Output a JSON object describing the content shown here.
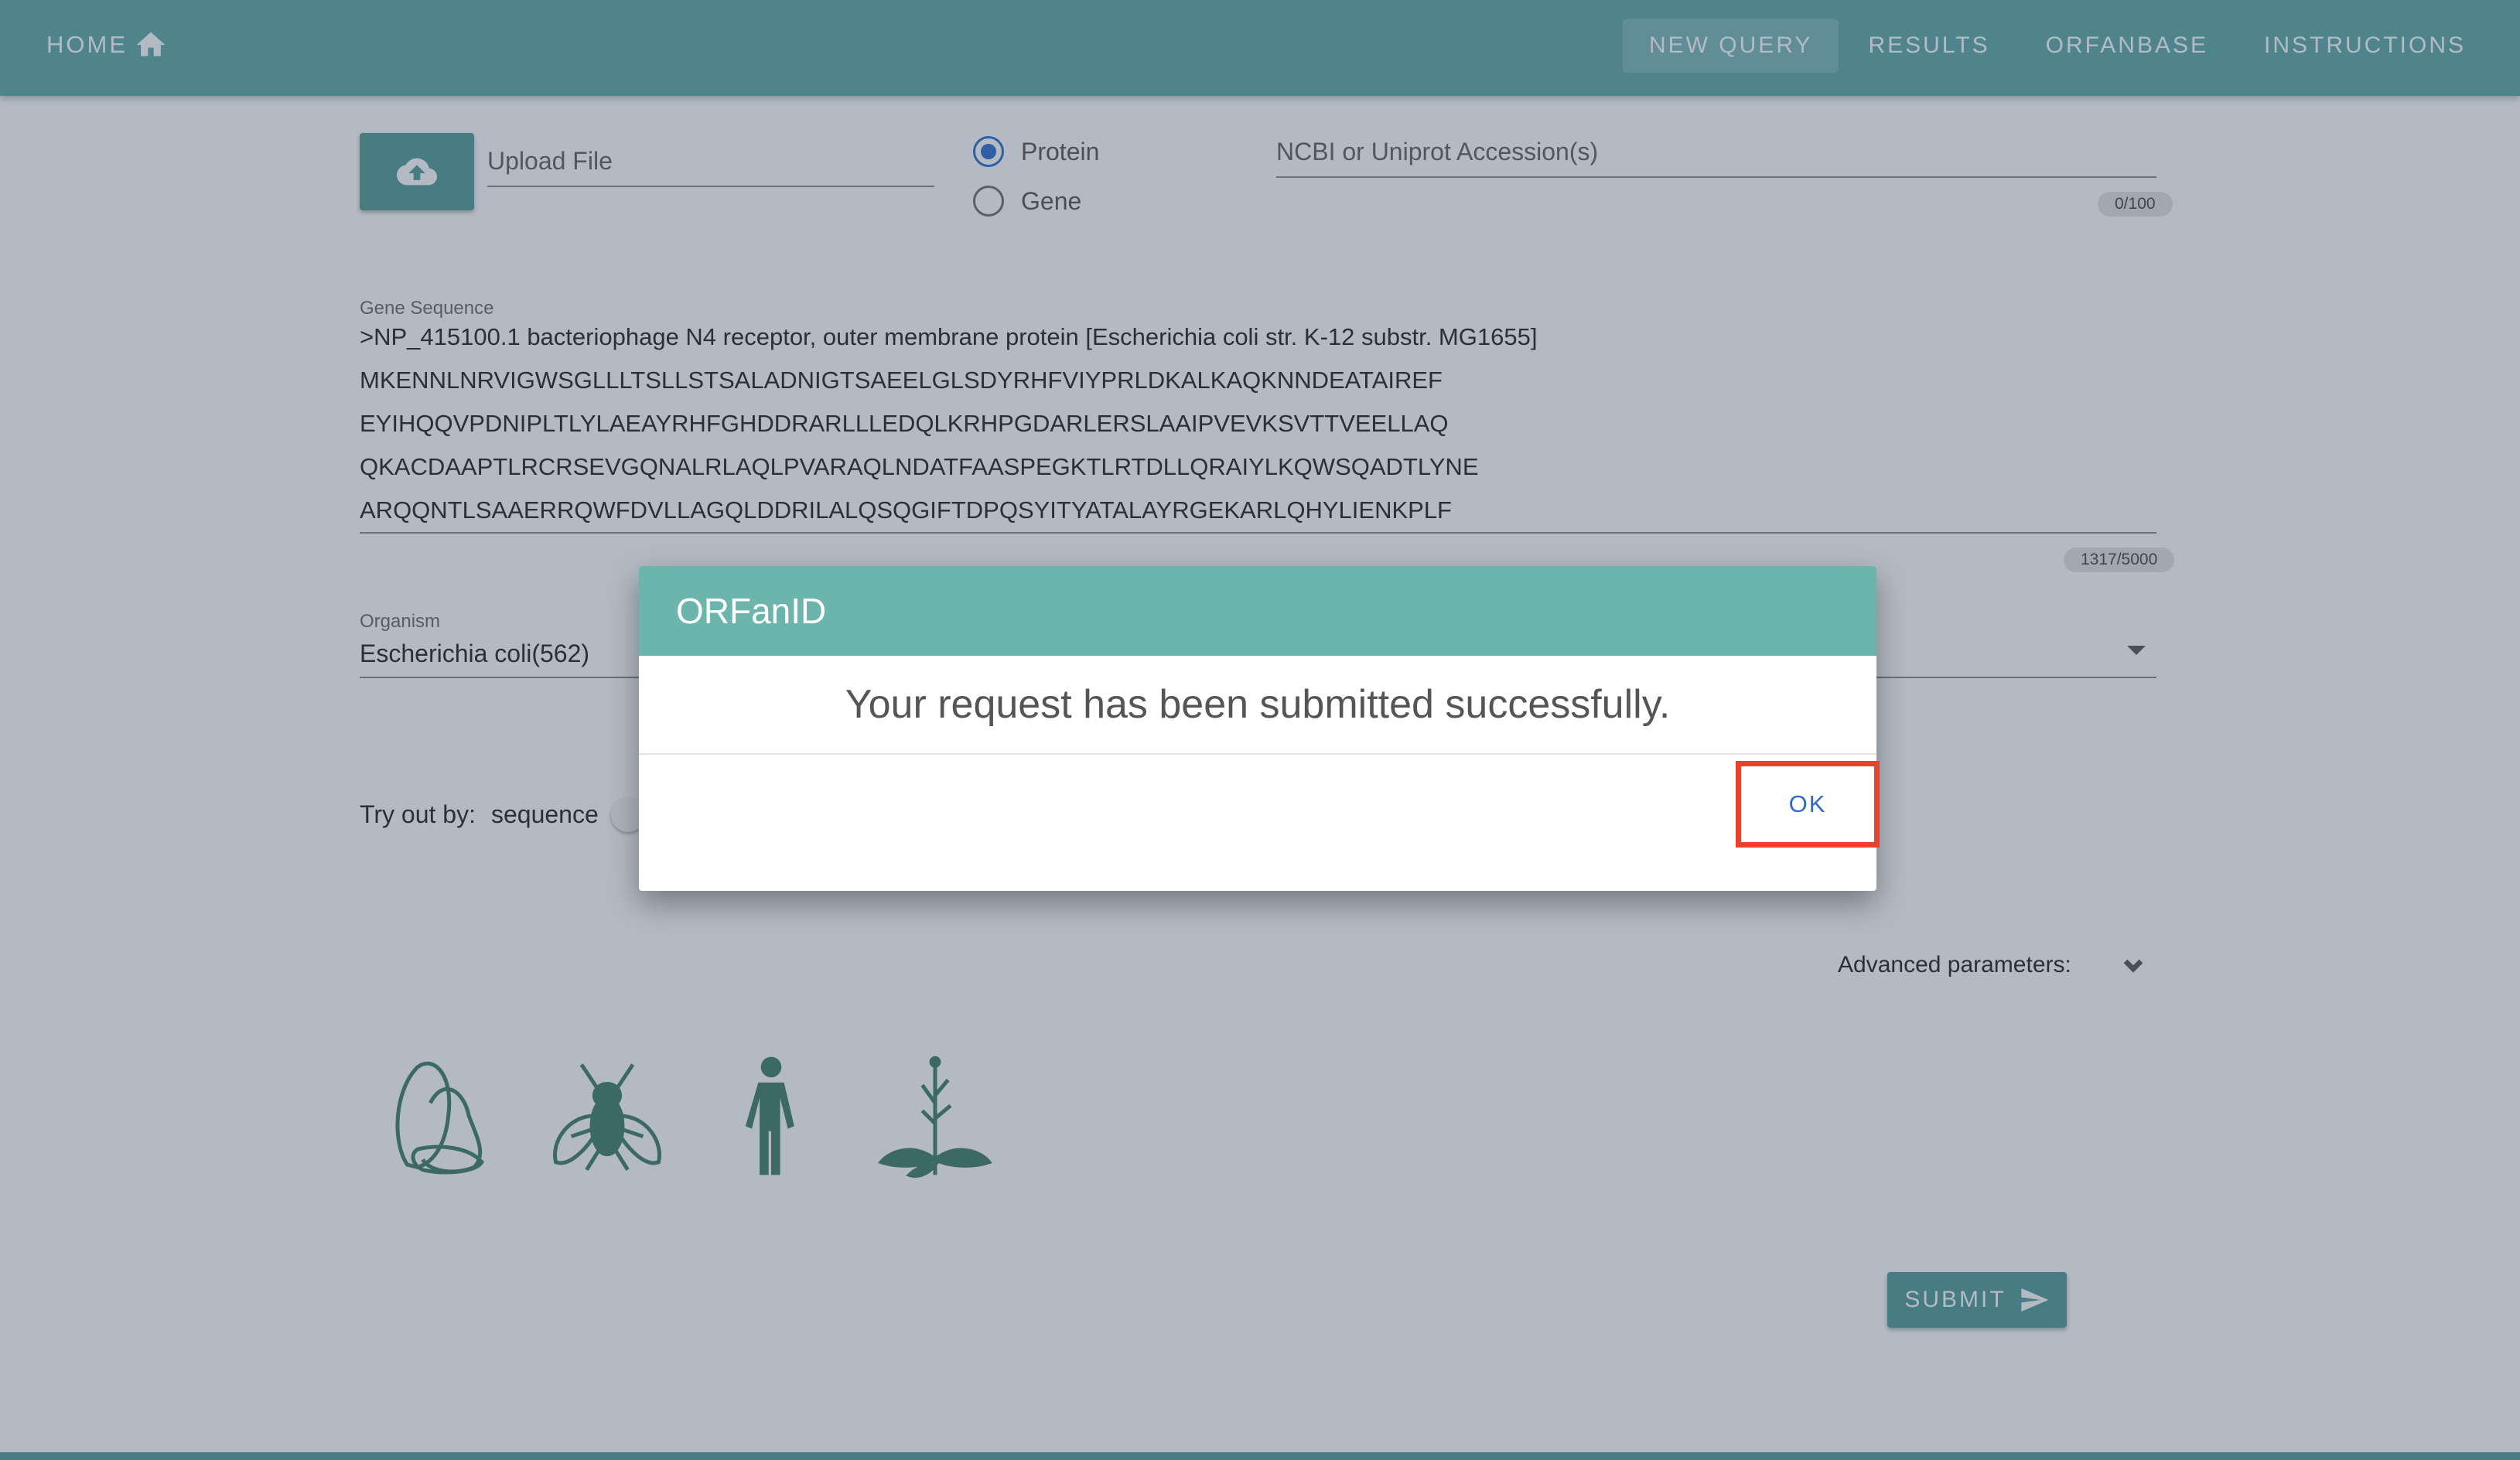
{
  "nav": {
    "home_label": "HOME",
    "links": [
      "NEW QUERY",
      "RESULTS",
      "ORFANBASE",
      "INSTRUCTIONS"
    ],
    "active": "NEW QUERY"
  },
  "form": {
    "upload_placeholder": "Upload File",
    "type_options": {
      "protein": "Protein",
      "gene": "Gene"
    },
    "selected_type": "Protein",
    "accession_placeholder": "NCBI or Uniprot Accession(s)",
    "accession_counter": "0/100",
    "sequence_label": "Gene Sequence",
    "sequence_lines": [
      ">NP_415100.1 bacteriophage N4 receptor, outer membrane protein [Escherichia coli str. K-12 substr. MG1655]",
      "MKENNLNRVIGWSGLLLTSLLSTSALADNIGTSAEELGLSDYRHFVIYPRLDKALKAQKNNDEATAIREF",
      "EYIHQQVPDNIPLTLYLAEAYRHFGHDDRARLLLEDQLKRHPGDARLERSLAAIPVEVKSVTTVEELLAQ",
      "QKACDAAPTLRCRSEVGQNALRLAQLPVARAQLNDATFAASPEGKTLRTDLLQRAIYLKQWSQADTLYNE",
      "ARQQNTLSAAERRQWFDVLLAGQLDDRILALQSQGIFTDPQSYITYATALAYRGEKARLQHYLIENKPLF"
    ],
    "sequence_counter": "1317/5000",
    "organism_label": "Organism",
    "organism_value": "Escherichia coli(562)",
    "tryout_label": "Try out by:",
    "tryout_option": "sequence",
    "advanced_label": "Advanced parameters:",
    "organism_icons": [
      "yeast-icon",
      "fly-icon",
      "human-icon",
      "plant-icon"
    ],
    "submit_label": "SUBMIT"
  },
  "dialog": {
    "title": "ORFanID",
    "message": "Your request has been submitted successfully.",
    "ok_label": "OK"
  },
  "colors": {
    "nav": "#5fa9a5",
    "button": "#4f9b95",
    "dialog_header": "#6bb5ad",
    "radio_selected": "#2f6cc9",
    "highlight": "#e8412c"
  }
}
